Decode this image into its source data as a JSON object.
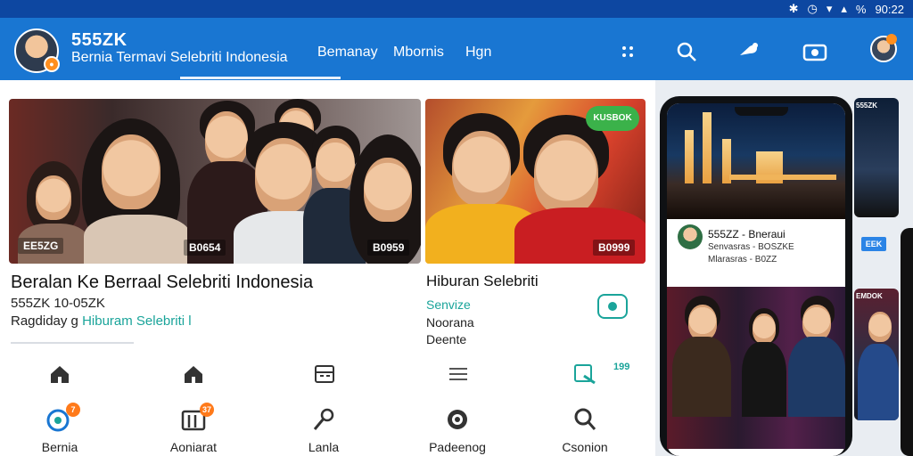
{
  "status": {
    "bt": "✱",
    "alarm": "◷",
    "wifi": "▾",
    "signal": "▴",
    "battery": "%",
    "time": "90:22"
  },
  "app": {
    "name": "555ZK",
    "subtitle_prefix": "Bernia Termavi",
    "subtitle_highlight": "Selebriti Indonesia",
    "tabs": [
      "Bemanay",
      "Mbornis",
      "Hgn"
    ]
  },
  "cards": [
    {
      "image_labels": [
        "EE5ZG",
        "B0654",
        "B0959"
      ],
      "title": "Beralan Ke Berraal Selebriti Indonesia",
      "meta1": "555ZK 10-05ZK",
      "meta2_prefix": "Ragdiday g",
      "meta2_link": "Hiburam Selebriti",
      "meta2_suffix": "l"
    },
    {
      "image_labels": [
        "B0999"
      ],
      "badge": "KUSBOK",
      "title": "Hiburan Selebriti",
      "meta1": "Senvize",
      "meta2": "Noorana",
      "meta3": "Deente"
    }
  ],
  "action_count": "199",
  "bottom_nav": [
    {
      "label": "Bernia",
      "badge": "7"
    },
    {
      "label": "Aoniarat",
      "badge": "37"
    },
    {
      "label": "Lanla",
      "badge": ""
    },
    {
      "label": "Padeenog",
      "badge": ""
    },
    {
      "label": "Csonion",
      "badge": ""
    }
  ],
  "phone": {
    "name": "555ZZ - Bneraui",
    "line2": "Senvasras - BOSZKE",
    "line3": "Mlarasras - B0ZZ",
    "button": "EEK",
    "side_top_tag": "555ZK",
    "side_bottom_tag": "EMDOK"
  }
}
